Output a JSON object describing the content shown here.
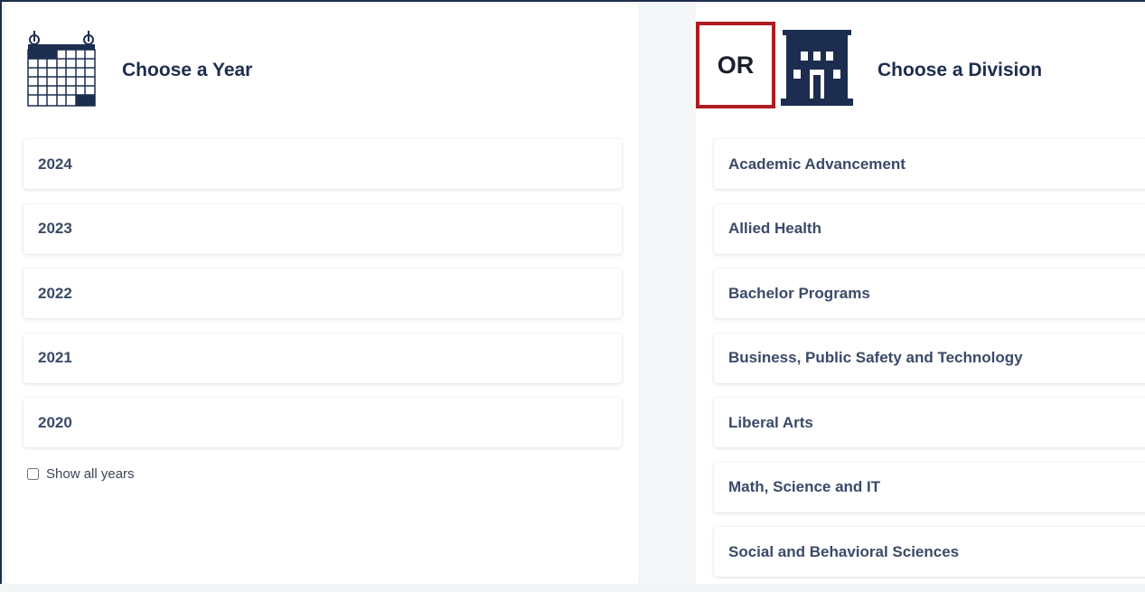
{
  "year_panel": {
    "title": "Choose a Year",
    "icon": "calendar-icon",
    "years": [
      "2024",
      "2023",
      "2022",
      "2021",
      "2020"
    ],
    "show_all_label": "Show all years",
    "show_all_checked": false
  },
  "separator": {
    "label": "OR",
    "highlight_color": "#b01b22"
  },
  "division_panel": {
    "title": "Choose a Division",
    "icon": "building-icon",
    "divisions": [
      "Academic Advancement",
      "Allied Health",
      "Bachelor Programs",
      "Business, Public Safety and Technology",
      "Liberal Arts",
      "Math, Science and IT",
      "Social and Behavioral Sciences"
    ]
  },
  "colors": {
    "navy": "#1c2d4f",
    "item_text": "#3a4a68",
    "accent_red": "#b01b22"
  }
}
